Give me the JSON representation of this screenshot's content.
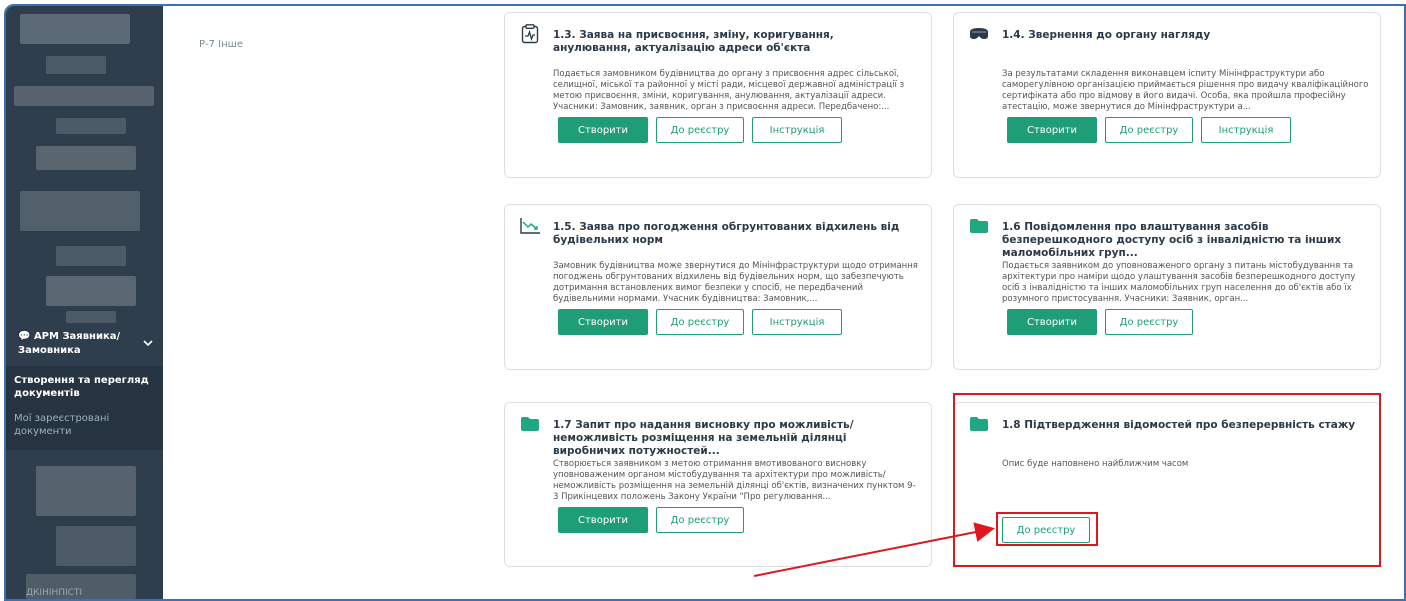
{
  "sidebar": {
    "apm_label": "АРМ Заявника/ Замовника",
    "submenu_active": "Створення та перегляд документів",
    "submenu_other": "Мої зареєстровані документи",
    "bottom_text": "ДКІНІНПІСТІ"
  },
  "category": "Р-7 Інше",
  "cards": [
    {
      "icon": "chart-doc-icon",
      "title": "1.3. Заява на присвоєння, зміну, коригування, анулювання, актуалізацію адреси об'єкта",
      "description": "Подається замовником будівництва до органу з присвоєння адрес сільської, селищної, міської та районної у місті ради, місцевої державної адміністрації з метою присвоєння, зміни, коригування, анулювання, актуалізації адреси. Учасники: Замовник, заявник, орган з присвоєння адреси. Передбачено:...",
      "btn_create": "Створити",
      "btn_registry": "До реєстру",
      "btn_instruction": "Інструкція"
    },
    {
      "icon": "mask-icon",
      "title": "1.4. Звернення до органу нагляду",
      "description": "За результатами складення виконавцем іспиту Мінінфраструктури або саморегулівною організацією приймається рішення про видачу кваліфікаційного сертифіката або про відмову в його видачі. Особа, яка пройшла професійну атестацію, може звернутися до Мінінфраструктури а...",
      "btn_create": "Створити",
      "btn_registry": "До реєстру",
      "btn_instruction": "Інструкція"
    },
    {
      "icon": "trend-down-icon",
      "title": "1.5. Заява про погодження обгрунтованих відхилень від будівельних норм",
      "description": "Замовник будівництва може звернутися до Мінінфраструктури щодо отримання погоджень обгрунтованих відхилень від будівельних норм, що забезпечують дотримання встановлених вимог безпеки у спосіб, не передбачений будівельними нормами. Учасник будівництва: Замовник,...",
      "btn_create": "Створити",
      "btn_registry": "До реєстру",
      "btn_instruction": "Інструкція"
    },
    {
      "icon": "folder-icon",
      "title": "1.6 Повідомлення про влаштування засобів безперешкодного доступу осіб з інвалідністю та інших маломобільних груп...",
      "description": "Подається заявником до уповноваженого органу з питань містобудування та архітектури про наміри щодо улаштування засобів безперешкодного доступу осіб з інвалідністю та інших маломобільних груп населення до об'єктів або їх розумного пристосування. Учасники: Заявник, орган...",
      "btn_create": "Створити",
      "btn_registry": "До реєстру"
    },
    {
      "icon": "folder-icon",
      "title": "1.7 Запит про надання висновку про можливість/неможливість розміщення на земельній ділянці виробничих потужностей...",
      "description": "Створюється заявником з метою отримання вмотивованого висновку уповноваженим органом містобудування та архітектури про можливість/ неможливість розміщення на земельній ділянці об'єктів, визначених пунктом 9-3 Прикінцевих положень Закону України \"Про регулювання...",
      "btn_create": "Створити",
      "btn_registry": "До реєстру"
    },
    {
      "icon": "folder-icon",
      "title": "1.8 Підтвердження відомостей про безперервність стажу",
      "description": "Опис буде наповнено найближчим часом",
      "btn_registry": "До реєстру"
    }
  ],
  "colors": {
    "accent": "#1e9e76",
    "sidebar": "#2f3e4d",
    "highlight": "#e0161e"
  }
}
